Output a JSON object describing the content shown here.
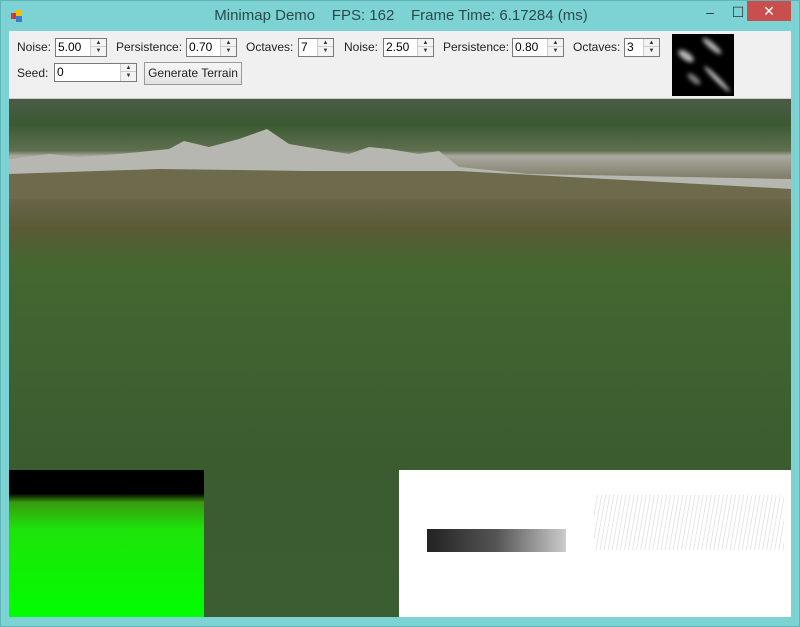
{
  "window": {
    "title": "Minimap Demo    FPS: 162    Frame Time: 6.17284 (ms)",
    "minimize": "–",
    "maximize": "☐",
    "close": "✕"
  },
  "toolbar": {
    "noise1_label": "Noise:",
    "noise1_value": "5.00",
    "persistence1_label": "Persistence:",
    "persistence1_value": "0.70",
    "octaves1_label": "Octaves:",
    "octaves1_value": "7",
    "noise2_label": "Noise:",
    "noise2_value": "2.50",
    "persistence2_label": "Persistence:",
    "persistence2_value": "0.80",
    "octaves2_label": "Octaves:",
    "octaves2_value": "3",
    "seed_label": "Seed:",
    "seed_value": "0",
    "generate_label": "Generate Terrain",
    "spin_up": "▲",
    "spin_down": "▼"
  }
}
